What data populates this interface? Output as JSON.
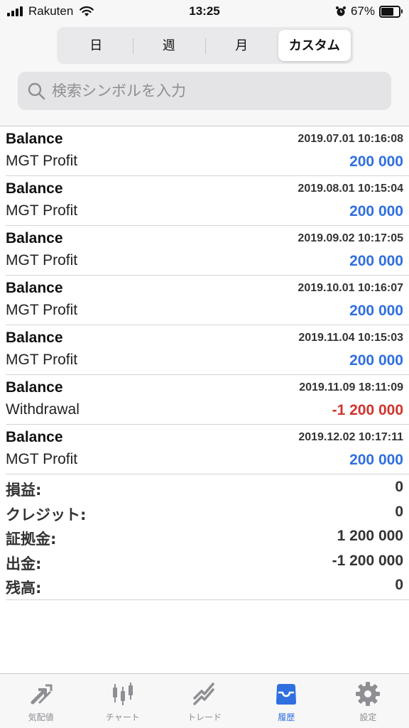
{
  "status_bar": {
    "carrier": "Rakuten",
    "time": "13:25",
    "battery": "67%"
  },
  "period_tabs": [
    "日",
    "週",
    "月",
    "カスタム"
  ],
  "period_selected": "カスタム",
  "search": {
    "placeholder": "検索シンボルを入力",
    "value": ""
  },
  "deals": [
    {
      "type": "Balance",
      "time": "2019.07.01 10:16:08",
      "comment": "MGT Profit",
      "amount": "200 000",
      "sign": "pos"
    },
    {
      "type": "Balance",
      "time": "2019.08.01 10:15:04",
      "comment": "MGT Profit",
      "amount": "200 000",
      "sign": "pos"
    },
    {
      "type": "Balance",
      "time": "2019.09.02 10:17:05",
      "comment": "MGT Profit",
      "amount": "200 000",
      "sign": "pos"
    },
    {
      "type": "Balance",
      "time": "2019.10.01 10:16:07",
      "comment": "MGT Profit",
      "amount": "200 000",
      "sign": "pos"
    },
    {
      "type": "Balance",
      "time": "2019.11.04 10:15:03",
      "comment": "MGT Profit",
      "amount": "200 000",
      "sign": "pos"
    },
    {
      "type": "Balance",
      "time": "2019.11.09 18:11:09",
      "comment": "Withdrawal",
      "amount": "-1 200 000",
      "sign": "neg"
    },
    {
      "type": "Balance",
      "time": "2019.12.02 10:17:11",
      "comment": "MGT Profit",
      "amount": "200 000",
      "sign": "pos"
    }
  ],
  "summary": [
    {
      "label": "損益:",
      "value": "0"
    },
    {
      "label": "クレジット:",
      "value": "0"
    },
    {
      "label": "証拠金:",
      "value": "1 200 000"
    },
    {
      "label": "出金:",
      "value": "-1 200 000"
    },
    {
      "label": "残高:",
      "value": "0"
    }
  ],
  "tabs": [
    {
      "label": "気配値",
      "icon": "quotes-arrows-icon"
    },
    {
      "label": "チャート",
      "icon": "candlestick-chart-icon"
    },
    {
      "label": "トレード",
      "icon": "trade-trend-icon"
    },
    {
      "label": "履歴",
      "icon": "history-inbox-icon"
    },
    {
      "label": "設定",
      "icon": "gear-icon"
    }
  ],
  "active_tab": "履歴",
  "colors": {
    "accent": "#2f6fe0",
    "negative": "#d0342c",
    "tab_inactive": "#8e8e93"
  }
}
